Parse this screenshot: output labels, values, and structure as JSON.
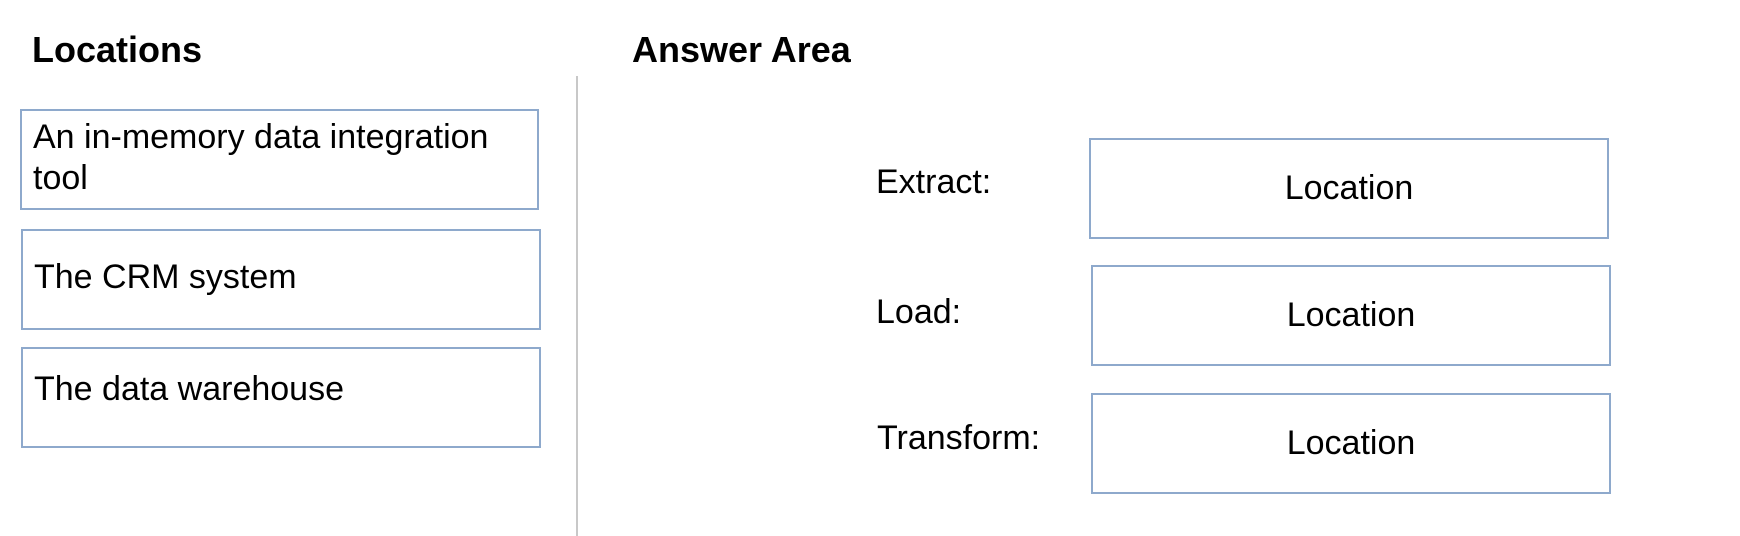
{
  "locations": {
    "heading": "Locations",
    "items": [
      {
        "label": "An in-memory data integration tool"
      },
      {
        "label": "The CRM system"
      },
      {
        "label": "The data warehouse"
      }
    ]
  },
  "answer_area": {
    "heading": "Answer Area",
    "steps": [
      {
        "label": "Extract:",
        "target": "Location"
      },
      {
        "label": "Load:",
        "target": "Location"
      },
      {
        "label": "Transform:",
        "target": "Location"
      }
    ]
  },
  "colors": {
    "box_border": "#8ea9cc",
    "divider": "#c8c8c8"
  }
}
